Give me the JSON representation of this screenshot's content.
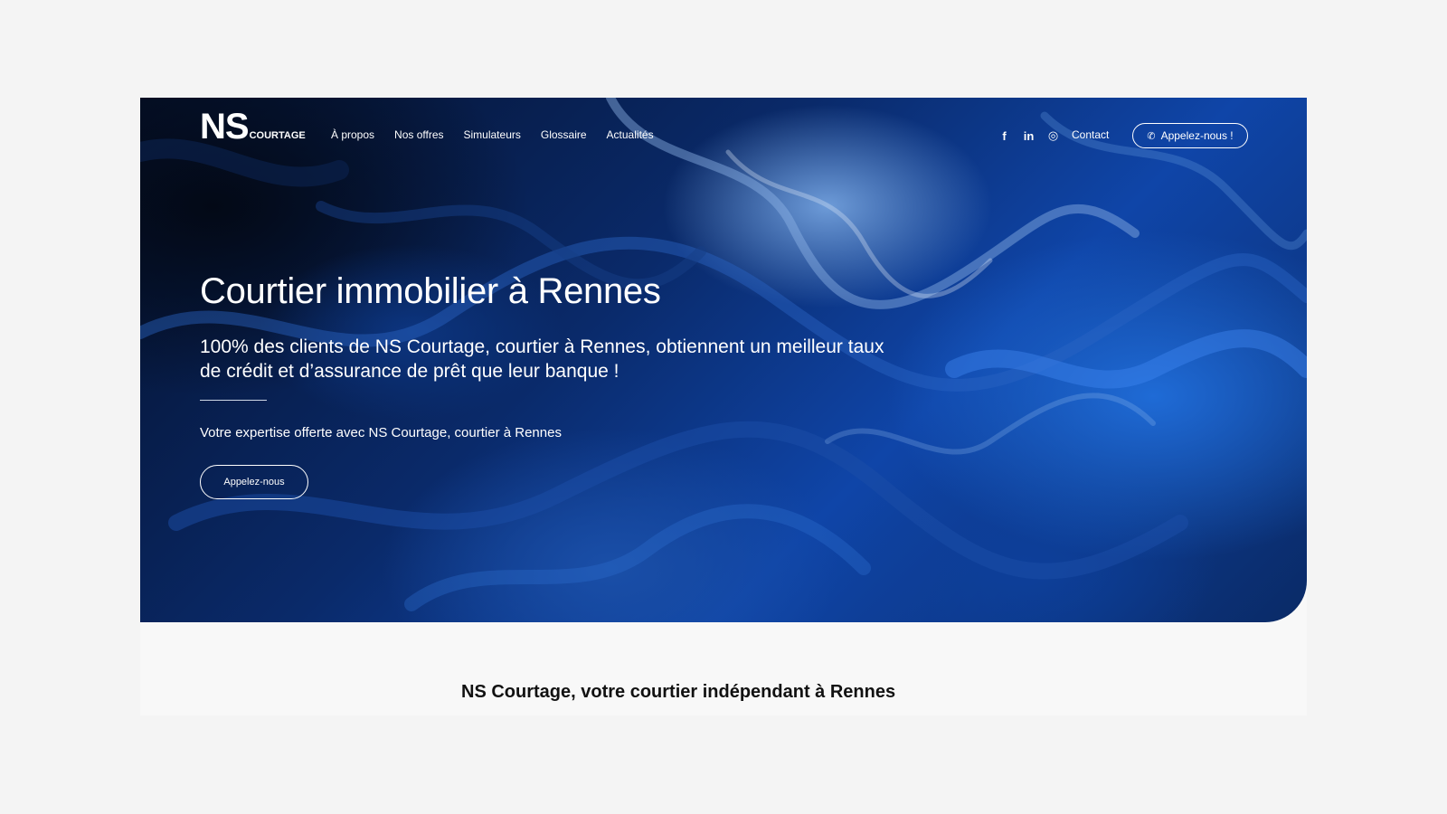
{
  "brand": {
    "main": "NS",
    "sub": "COURTAGE"
  },
  "nav": {
    "items": [
      {
        "label": "À propos"
      },
      {
        "label": "Nos offres"
      },
      {
        "label": "Simulateurs"
      },
      {
        "label": "Glossaire"
      },
      {
        "label": "Actualités"
      }
    ],
    "social": [
      {
        "icon": "facebook-icon",
        "glyph": "f"
      },
      {
        "icon": "linkedin-icon",
        "glyph": "in"
      },
      {
        "icon": "instagram-icon",
        "glyph": "◎"
      }
    ],
    "contact_label": "Contact",
    "call_label": "Appelez-nous !"
  },
  "hero": {
    "title": "Courtier immobilier à Rennes",
    "lead": "100% des clients de NS Courtage, courtier à Rennes, obtiennent un meilleur taux de crédit et d’assurance de prêt que leur banque !",
    "subtitle": "Votre expertise offerte avec NS Courtage, courtier à Rennes",
    "cta_label": "Appelez-nous"
  },
  "section": {
    "title": "NS Courtage, votre courtier indépendant à Rennes"
  },
  "colors": {
    "page_bg": "#f4f4f4",
    "hero_dark": "#04102a",
    "hero_blue": "#0f45a8",
    "text_light": "#ffffff",
    "text_dark": "#111111"
  }
}
